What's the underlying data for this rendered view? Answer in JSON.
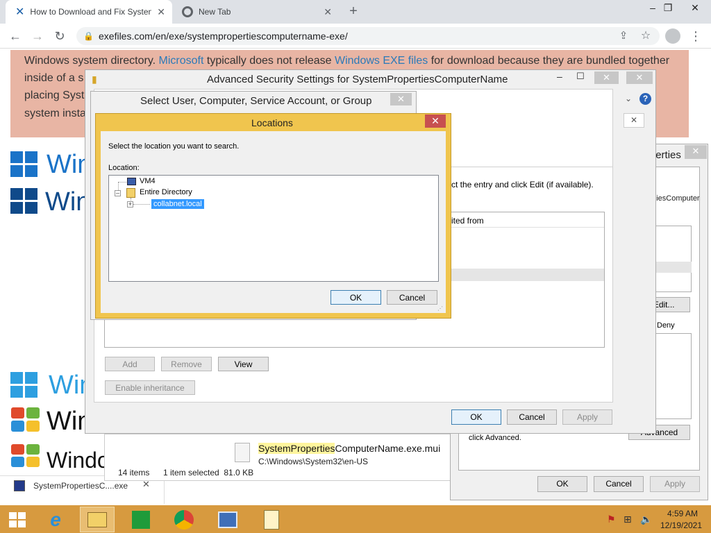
{
  "browser": {
    "tabs": [
      {
        "title": "How to Download and Fix Systen",
        "icon": "x-logo-icon"
      },
      {
        "title": "New Tab",
        "icon": "chrome-icon"
      }
    ],
    "url": "exefiles.com/en/exe/systempropertiescomputername-exe/"
  },
  "page": {
    "para_line1_a": "Windows system directory. ",
    "para_link1": "Microsoft",
    "para_line1_b": " typically does not release ",
    "para_link2": "Windows EXE files",
    "para_line1_c": " for download because they are bundled together",
    "para_line2": "inside of a s",
    "para_line3": "placing Syst",
    "para_line4": "system insta",
    "word1": "Win",
    "word2": "Wind",
    "word3": "Win",
    "word4": "Win",
    "word5": "Windo"
  },
  "download_bar": {
    "filename": "SystemPropertiesC....exe"
  },
  "explorer": {
    "file_name": "SystemPropertiesComputerName.exe.mui",
    "file_name_highlight": "SystemProperties",
    "file_path": "C:\\Windows\\System32\\en-US",
    "items_count": "14 items",
    "selected": "1 item selected  81.0 KB"
  },
  "properties": {
    "title_fragment": "e Properties",
    "object_fragment": "mPropertiesComputer",
    "edit_label": "Edit...",
    "col_allow_fragment": "w",
    "col_deny": "Deny",
    "advanced_hint": "click Advanced.",
    "advanced_label": "Advanced",
    "ok": "OK",
    "cancel": "Cancel",
    "apply": "Apply"
  },
  "adv_security": {
    "title": "Advanced Security Settings for SystemPropertiesComputerName",
    "hint_fragment": "ct the entry and click Edit (if available).",
    "col_inherited": "ited from",
    "add": "Add",
    "remove": "Remove",
    "view": "View",
    "enable_inheritance": "Enable inheritance",
    "ok": "OK",
    "cancel": "Cancel",
    "apply": "Apply"
  },
  "select_user": {
    "title": "Select User, Computer, Service Account, or Group"
  },
  "locations": {
    "title": "Locations",
    "instruction": "Select the location you want to search.",
    "location_label": "Location:",
    "tree": {
      "node1": "VM4",
      "node2": "Entire Directory",
      "node3": "collabnet.local"
    },
    "ok": "OK",
    "cancel": "Cancel"
  },
  "clock": {
    "time": "4:59 AM",
    "date": "12/19/2021"
  },
  "colors": {
    "taskbar": "#d79a3f",
    "locations_frame": "#f0c54e",
    "selection": "#3399ff",
    "link": "#2b7ab8"
  }
}
